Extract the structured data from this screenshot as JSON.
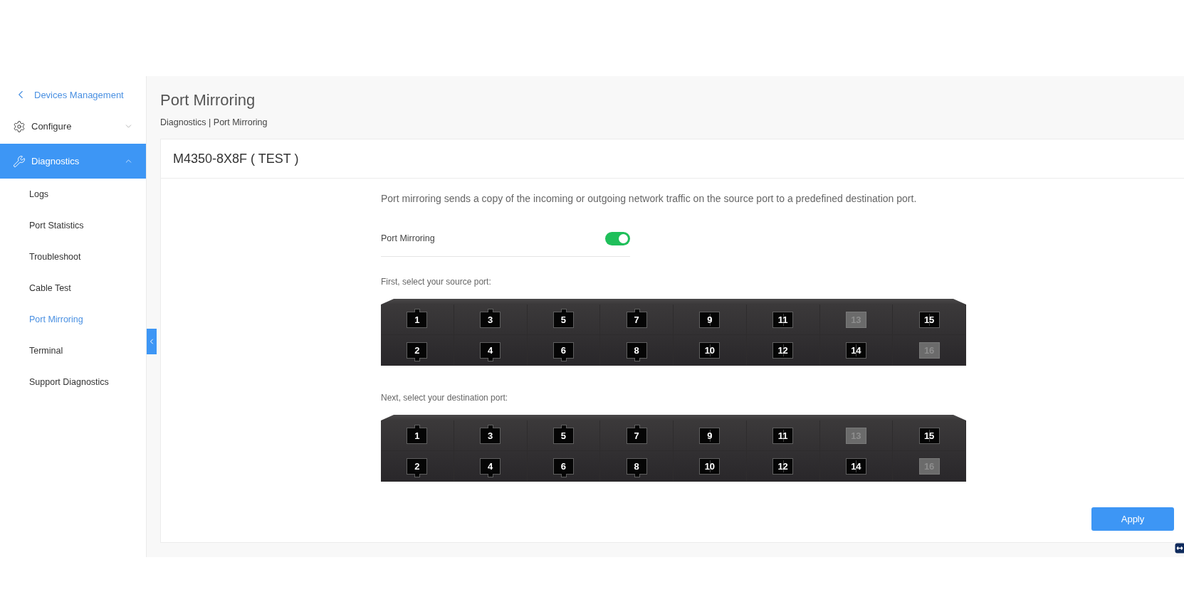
{
  "sidebar": {
    "back_link": "Devices Management",
    "items": [
      {
        "label": "Configure",
        "selected": false,
        "expanded": false
      },
      {
        "label": "Diagnostics",
        "selected": true,
        "expanded": true,
        "children": [
          {
            "label": "Logs",
            "selected": false
          },
          {
            "label": "Port Statistics",
            "selected": false
          },
          {
            "label": "Troubleshoot",
            "selected": false
          },
          {
            "label": "Cable Test",
            "selected": false
          },
          {
            "label": "Port Mirroring",
            "selected": true
          },
          {
            "label": "Terminal",
            "selected": false
          },
          {
            "label": "Support Diagnostics",
            "selected": false
          }
        ]
      }
    ]
  },
  "page": {
    "title": "Port Mirroring",
    "breadcrumb": "Diagnostics | Port Mirroring"
  },
  "card": {
    "title": "M4350-8X8F ( TEST )",
    "description": "Port mirroring sends a copy of the incoming or outgoing network traffic on the source port to a predefined destination port.",
    "toggle": {
      "label": "Port Mirroring",
      "on": true
    },
    "panels": [
      {
        "label": "First, select your source port:",
        "ports": [
          {
            "label": "1",
            "kind": "rj45",
            "disabled": false
          },
          {
            "label": "2",
            "kind": "rj45",
            "disabled": false
          },
          {
            "label": "3",
            "kind": "rj45",
            "disabled": false
          },
          {
            "label": "4",
            "kind": "rj45",
            "disabled": false
          },
          {
            "label": "5",
            "kind": "rj45",
            "disabled": false
          },
          {
            "label": "6",
            "kind": "rj45",
            "disabled": false
          },
          {
            "label": "7",
            "kind": "rj45",
            "disabled": false
          },
          {
            "label": "8",
            "kind": "rj45",
            "disabled": false
          },
          {
            "label": "9",
            "kind": "sfp",
            "disabled": false
          },
          {
            "label": "10",
            "kind": "sfp",
            "disabled": false
          },
          {
            "label": "11",
            "kind": "sfp",
            "disabled": false
          },
          {
            "label": "12",
            "kind": "sfp",
            "disabled": false
          },
          {
            "label": "13",
            "kind": "sfp",
            "disabled": true
          },
          {
            "label": "14",
            "kind": "sfp",
            "disabled": false
          },
          {
            "label": "15",
            "kind": "sfp",
            "disabled": false
          },
          {
            "label": "16",
            "kind": "sfp",
            "disabled": true
          }
        ]
      },
      {
        "label": "Next, select your destination port:",
        "ports": [
          {
            "label": "1",
            "kind": "rj45",
            "disabled": false
          },
          {
            "label": "2",
            "kind": "rj45",
            "disabled": false
          },
          {
            "label": "3",
            "kind": "rj45",
            "disabled": false
          },
          {
            "label": "4",
            "kind": "rj45",
            "disabled": false
          },
          {
            "label": "5",
            "kind": "rj45",
            "disabled": false
          },
          {
            "label": "6",
            "kind": "rj45",
            "disabled": false
          },
          {
            "label": "7",
            "kind": "rj45",
            "disabled": false
          },
          {
            "label": "8",
            "kind": "rj45",
            "disabled": false
          },
          {
            "label": "9",
            "kind": "sfp",
            "disabled": false
          },
          {
            "label": "10",
            "kind": "sfp",
            "disabled": false
          },
          {
            "label": "11",
            "kind": "sfp",
            "disabled": false
          },
          {
            "label": "12",
            "kind": "sfp",
            "disabled": false
          },
          {
            "label": "13",
            "kind": "sfp",
            "disabled": true
          },
          {
            "label": "14",
            "kind": "sfp",
            "disabled": false
          },
          {
            "label": "15",
            "kind": "sfp",
            "disabled": false
          },
          {
            "label": "16",
            "kind": "sfp",
            "disabled": true
          }
        ]
      }
    ],
    "apply_button": "Apply"
  }
}
